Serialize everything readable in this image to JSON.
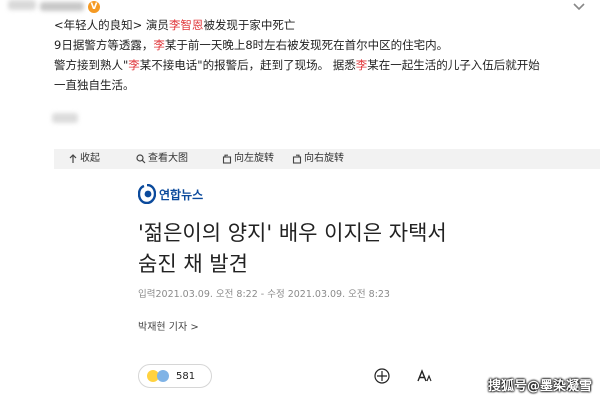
{
  "post": {
    "line1_part1": "<年轻人的良知> 演员",
    "line1_name": "李智恩",
    "line1_part2": "被发现于家中死亡",
    "line2_part1": "9日据警方等透露，",
    "line2_name": "李",
    "line2_part2": "某于前一天晚上8时左右被发现死在首尔中区的住宅内。",
    "line3_part1": "警方接到熟人\"",
    "line3_name1": "李",
    "line3_part2": "某不接电话\"的报警后，赶到了现场。 据悉",
    "line3_name2": "李",
    "line3_part3": "某在一起生活的儿子入伍后就开始",
    "line4": "一直独自生活。"
  },
  "toolbar": {
    "collapse": "收起",
    "view_large": "查看大图",
    "rotate_left": "向左旋转",
    "rotate_right": "向右旋转"
  },
  "article": {
    "logo_text": "연합뉴스",
    "title_line1": "'젊은이의 양지' 배우 이지은 자택서",
    "title_line2": "숨진 채 발견",
    "meta": "입력2021.03.09. 오전 8:22 - 수정 2021.03.09. 오전 8:23",
    "byline": "박재현 기자 >",
    "reaction_count": "581"
  },
  "watermark": "搜狐号@墨染凝雪",
  "colors": {
    "highlight": "#e0373b",
    "toolbar_bg": "#f2f2f2",
    "logo": "#0b4a9c"
  }
}
